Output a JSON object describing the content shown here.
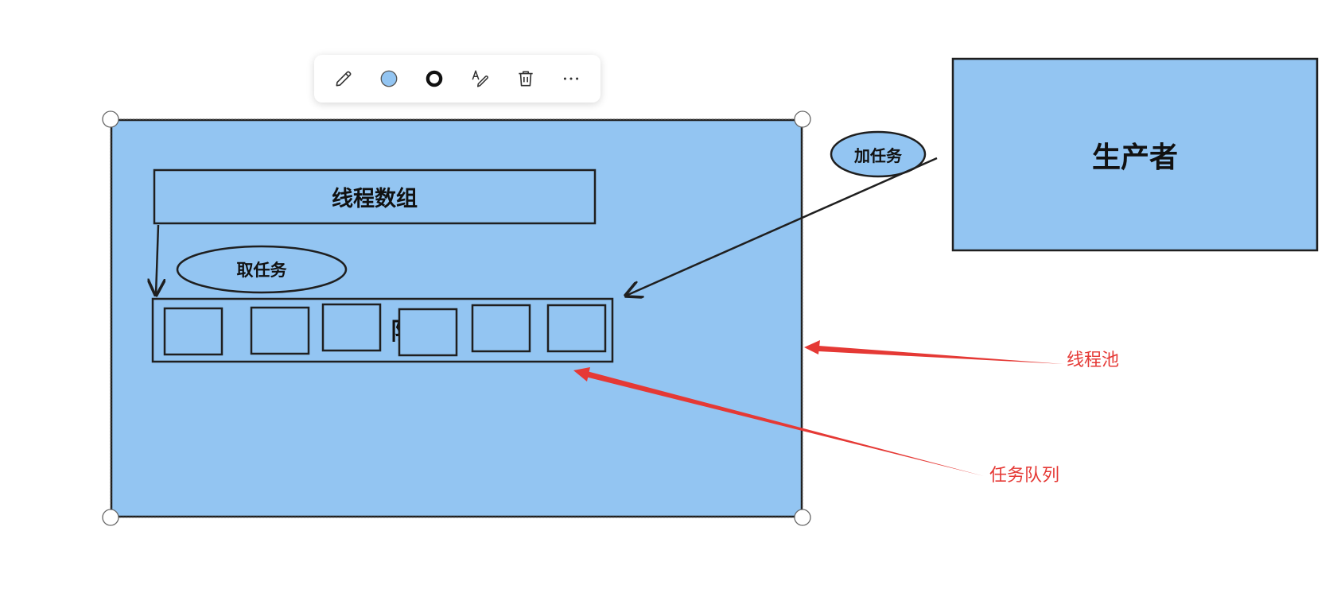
{
  "toolbar": {
    "buttons": [
      {
        "icon": "pencil-icon"
      },
      {
        "icon": "fill-color-icon",
        "color": "#93c5f2"
      },
      {
        "icon": "stroke-style-icon"
      },
      {
        "icon": "text-style-icon"
      },
      {
        "icon": "trash-icon"
      },
      {
        "icon": "more-options-icon"
      }
    ]
  },
  "diagram": {
    "colors": {
      "fill": "#93c5f2",
      "stroke": "#1f1f1f",
      "annotation": "#e53935"
    },
    "thread_array_label": "线程数组",
    "take_task_label": "取任务",
    "add_task_label": "加任务",
    "producer_label": "生产者",
    "queue_partial_text": "队",
    "annotations": {
      "thread_pool": "线程池",
      "task_queue": "任务队列"
    }
  }
}
